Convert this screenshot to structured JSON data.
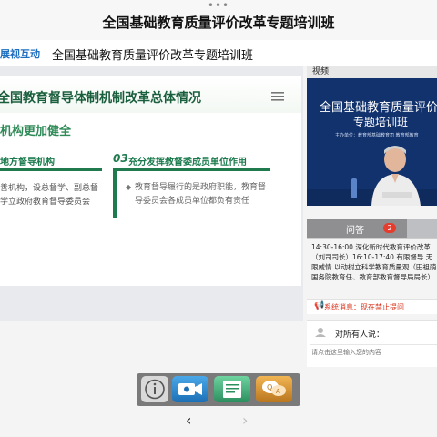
{
  "window": {
    "grabber": "•••",
    "title": "全国基础教育质量评价改革专题培训班"
  },
  "subbar": {
    "tab": "展视互动",
    "title": "全国基础教育质量评价改革专题培训班"
  },
  "slide": {
    "title": "全国教育督导体制机制改革总体情况",
    "section": "机构更加健全",
    "col1": {
      "head": "地方督导机构",
      "body": "善机构，设总督学、副总督学立政府教育督导委员会"
    },
    "col2": {
      "number": "03",
      "head": "充分发挥教督委成员单位作用",
      "bullet": "◆",
      "body": "教育督导履行的是政府职能，教育督导委员会各成员单位都负有责任"
    }
  },
  "video": {
    "label": "视频",
    "title_line1": "全国基础教育质量评价",
    "title_line2": "专题培训班",
    "caption": "主办单位：教育部基础教育司  教育部教育"
  },
  "qa": {
    "tab_label": "问答",
    "badge": "2",
    "schedule": "14:30-16:00 深化新时代教育评价改革（刘司司长）16:10-17:40 有限督导 无限威情 以动树立科学教育质量观（田祖荫 国务院教育任、教育部教育督导局局长）",
    "system_label": "系统消息：现在禁止提问",
    "chat_label": "对所有人说：",
    "chat_placeholder": "请点击这里输入您的内容"
  },
  "toolbar": {
    "info_icon": "info-icon",
    "video_icon": "video-camera-icon",
    "doc_icon": "document-icon",
    "qa_icon": "qa-bubble-icon"
  },
  "nav": {
    "back": "‹",
    "forward": "›"
  },
  "colors": {
    "slide_green": "#1f7a4e",
    "video_blue": "#12326e",
    "badge_red": "#e53c2e",
    "system_red": "#d9341e"
  }
}
